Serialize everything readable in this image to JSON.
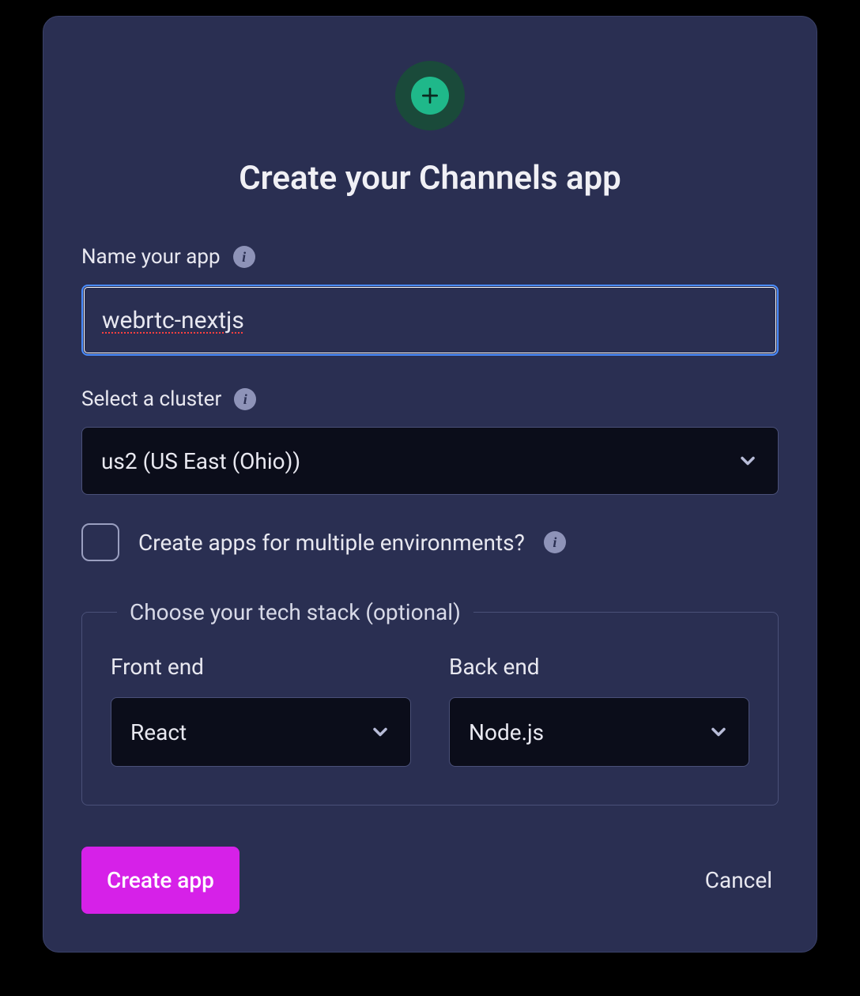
{
  "modal": {
    "title": "Create your Channels app",
    "name_field": {
      "label": "Name your app",
      "value": "webrtc-nextjs"
    },
    "cluster_field": {
      "label": "Select a cluster",
      "selected": "us2 (US East (Ohio))"
    },
    "multi_env": {
      "label": "Create apps for multiple environments?",
      "checked": false
    },
    "tech_stack": {
      "legend": "Choose your tech stack (optional)",
      "frontend": {
        "label": "Front end",
        "selected": "React"
      },
      "backend": {
        "label": "Back end",
        "selected": "Node.js"
      }
    },
    "actions": {
      "primary": "Create app",
      "cancel": "Cancel"
    }
  },
  "icons": {
    "info": "i"
  }
}
